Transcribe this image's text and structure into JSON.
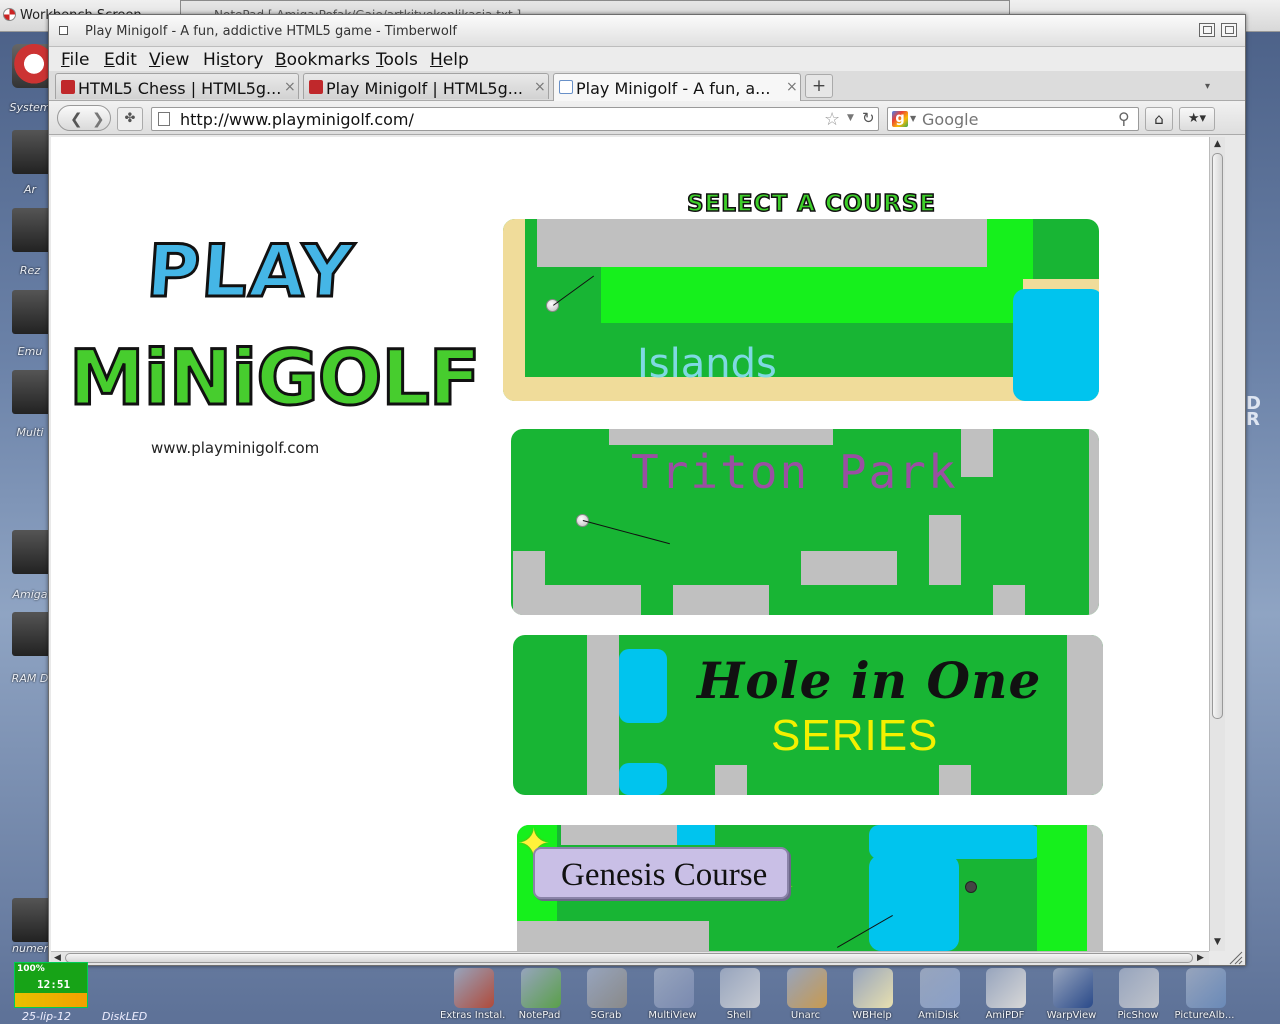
{
  "workbench": {
    "screen_title": "Workbench Screen",
    "background_window_title": "NotePad [ Amiga:Pofak/Gaje/artkitvekonlikasia.txt ]",
    "right_edge_text": "D\nR"
  },
  "desktop_icons": [
    {
      "label": "System"
    },
    {
      "label": "Ar"
    },
    {
      "label": "Rez"
    },
    {
      "label": "Emu"
    },
    {
      "label": "Multi"
    },
    {
      "label": "Amiga"
    },
    {
      "label": "RAM D"
    },
    {
      "label": "numer"
    }
  ],
  "window": {
    "title": "Play Minigolf - A fun, addictive HTML5 game - Timberwolf"
  },
  "menu": [
    {
      "label": "File",
      "key": "F"
    },
    {
      "label": "Edit",
      "key": "E"
    },
    {
      "label": "View",
      "key": "V"
    },
    {
      "label": "History",
      "key": "s"
    },
    {
      "label": "Bookmarks",
      "key": "B"
    },
    {
      "label": "Tools",
      "key": "T"
    },
    {
      "label": "Help",
      "key": "H"
    }
  ],
  "tabs": [
    {
      "label": "HTML5 Chess | HTML5g...",
      "active": false
    },
    {
      "label": "Play Minigolf | HTML5g...",
      "active": false
    },
    {
      "label": "Play Minigolf - A fun, a...",
      "active": true
    }
  ],
  "new_tab_label": "+",
  "navbar": {
    "url": "http://www.playminigolf.com/",
    "search_placeholder": "Google"
  },
  "page": {
    "logo_line1": "PLAY",
    "logo_line2": "MiNiGOLF",
    "site_url": "www.playminigolf.com",
    "heading": "SELECT A COURSE",
    "courses": [
      {
        "name": "Islands"
      },
      {
        "name": "Triton Park"
      },
      {
        "name": "Hole in One",
        "subtitle": "SERIES"
      },
      {
        "name": "Genesis Course"
      }
    ]
  },
  "clock": {
    "percent": "100%",
    "time": "12:51",
    "date": "25-lip-12",
    "widget_label": "DiskLED"
  },
  "dock": [
    {
      "label": "Extras Instal...",
      "color": "#b04a3a"
    },
    {
      "label": "NotePad",
      "color": "#5aa04a"
    },
    {
      "label": "SGrab",
      "color": "#8a8a8a"
    },
    {
      "label": "MultiView",
      "color": "#7a8ab0"
    },
    {
      "label": "Shell",
      "color": "#c8ccd4"
    },
    {
      "label": "Unarc",
      "color": "#c89a50"
    },
    {
      "label": "WBHelp",
      "color": "#e8e0b0"
    },
    {
      "label": "AmiDisk",
      "color": "#8aa0c8"
    },
    {
      "label": "AmiPDF",
      "color": "#d8d8d8"
    },
    {
      "label": "WarpView",
      "color": "#2a4a8a"
    },
    {
      "label": "PicShow",
      "color": "#c0c4cc"
    },
    {
      "label": "PictureAlb...",
      "color": "#6a8ab8"
    }
  ]
}
